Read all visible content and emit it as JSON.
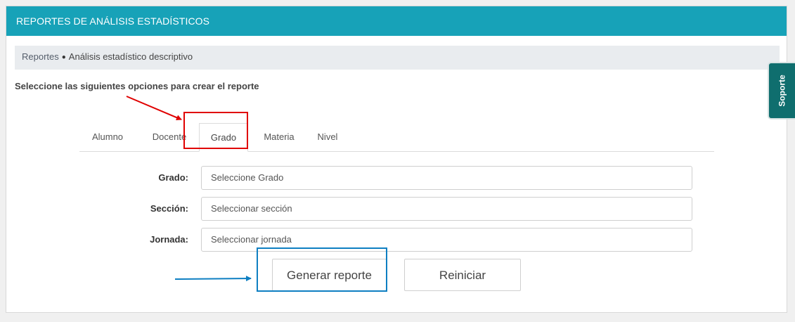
{
  "header": {
    "title": "REPORTES DE ANÁLISIS ESTADÍSTICOS"
  },
  "breadcrumb": {
    "parent": "Reportes",
    "separator": "●",
    "current": "Análisis estadístico descriptivo"
  },
  "instructions": "Seleccione las siguientes opciones para crear el reporte",
  "tabs": [
    {
      "label": "Alumno",
      "active": false
    },
    {
      "label": "Docente",
      "active": false
    },
    {
      "label": "Grado",
      "active": true
    },
    {
      "label": "Materia",
      "active": false
    },
    {
      "label": "Nivel",
      "active": false
    }
  ],
  "form": {
    "grado": {
      "label": "Grado:",
      "value": "Seleccione Grado"
    },
    "seccion": {
      "label": "Sección:",
      "value": "Seleccionar sección"
    },
    "jornada": {
      "label": "Jornada:",
      "value": "Seleccionar jornada"
    }
  },
  "buttons": {
    "generate": "Generar reporte",
    "reset": "Reiniciar"
  },
  "support_tab": "Soporte",
  "colors": {
    "header": "#17a2b8",
    "support_tab": "#0f6e6e",
    "highlight_red": "#e00000",
    "highlight_blue": "#0e7fc2"
  }
}
